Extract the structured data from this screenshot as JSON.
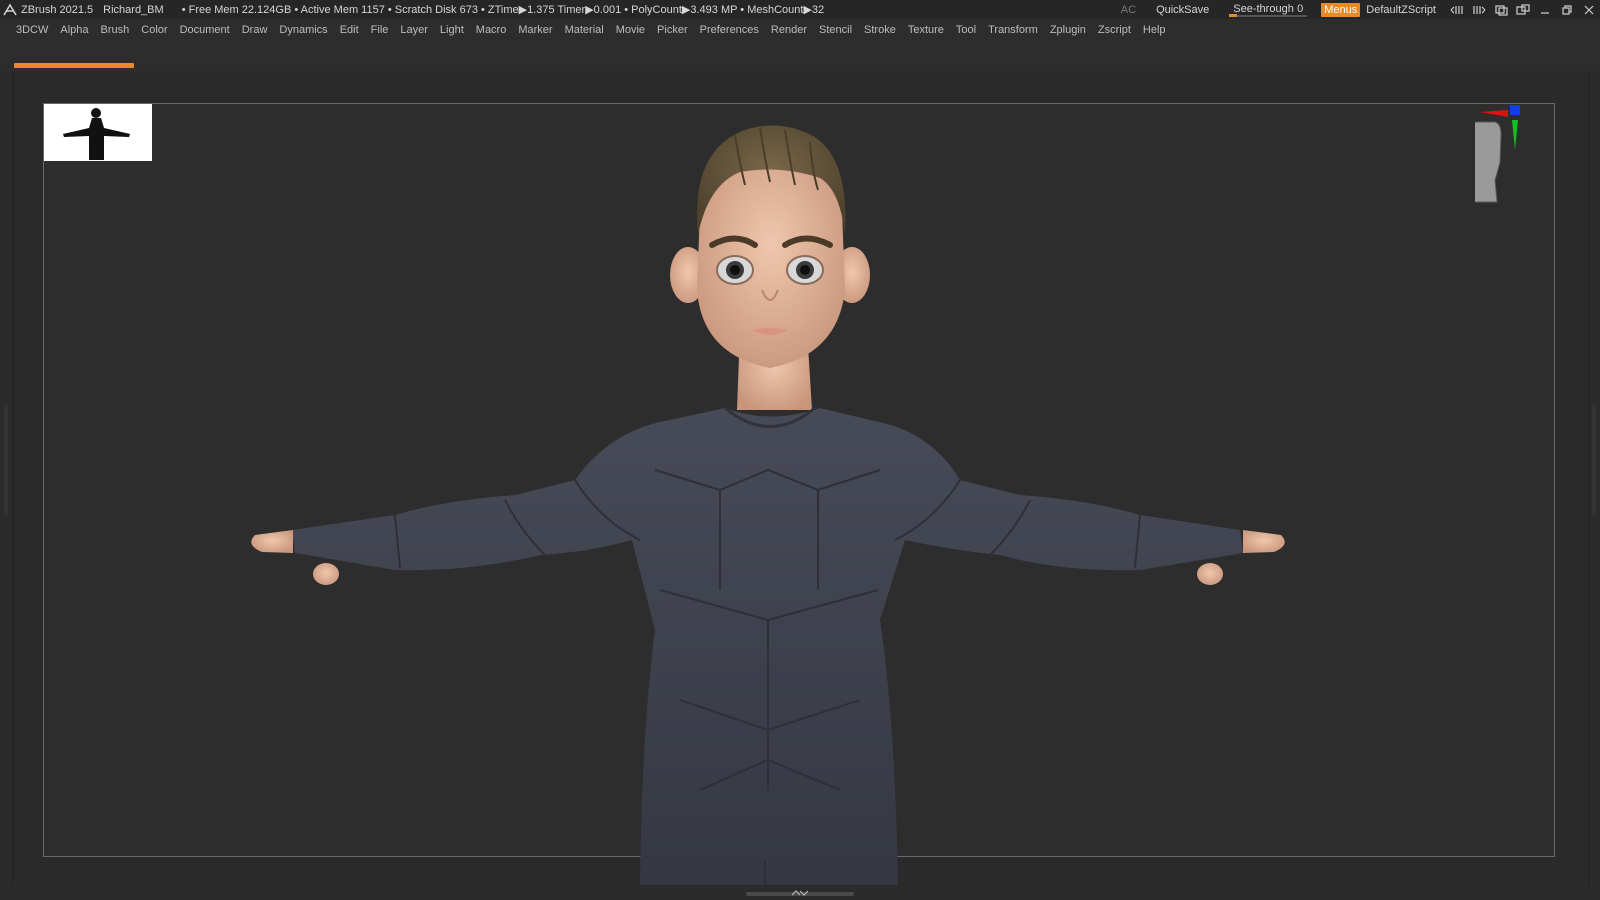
{
  "titlebar": {
    "app_title": "ZBrush 2021.5",
    "project": "Richard_BM",
    "stats": "• Free Mem 22.124GB • Active Mem 1157 • Scratch Disk 673 • ZTime▶1.375 Timer▶0.001 • PolyCount▶3.493 MP • MeshCount▶32",
    "ac_label": "AC",
    "quicksave_label": "QuickSave",
    "seethrough_label": "See-through",
    "seethrough_value": "0",
    "seethrough_fraction": 0,
    "menus_label": "Menus",
    "script_label": "DefaultZScript"
  },
  "menu": {
    "items": [
      "3DCW",
      "Alpha",
      "Brush",
      "Color",
      "Document",
      "Draw",
      "Dynamics",
      "Edit",
      "File",
      "Layer",
      "Light",
      "Macro",
      "Marker",
      "Material",
      "Movie",
      "Picker",
      "Preferences",
      "Render",
      "Stencil",
      "Stroke",
      "Texture",
      "Tool",
      "Transform",
      "Zplugin",
      "Zscript",
      "Help"
    ]
  },
  "colors": {
    "accent": "#e8892c",
    "background": "#2b2b2b",
    "suit": "#3d414c",
    "skin": "#e6b79f",
    "hair": "#6b5a40",
    "axis_x": "#e01010",
    "axis_y": "#10c020",
    "axis_z": "#1040e0"
  },
  "icons": {
    "app_logo": "zbrush-logo-icon",
    "navigator": "navigator-silhouette",
    "gizmo": "orientation-head-icon",
    "minimize": "minimize-icon",
    "restore": "restore-icon",
    "close": "close-icon"
  }
}
